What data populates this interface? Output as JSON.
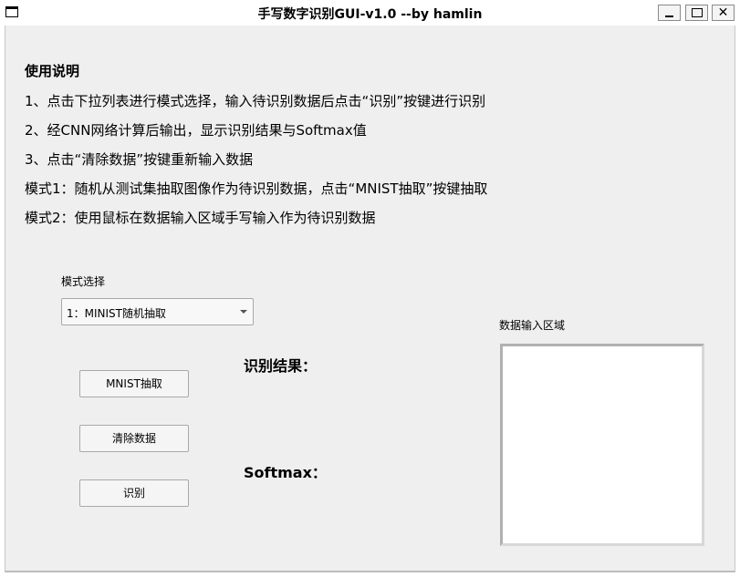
{
  "window": {
    "title": "手写数字识别GUI-v1.0 --by hamlin",
    "controls": [
      "minimize",
      "maximize",
      "close"
    ]
  },
  "instructions": {
    "heading": "使用说明",
    "lines": [
      "1、点击下拉列表进行模式选择，输入待识别数据后点击“识别”按键进行识别",
      "2、经CNN网络计算后输出，显示识别结果与Softmax值",
      "3、点击“清除数据”按键重新输入数据",
      "模式1：随机从测试集抽取图像作为待识别数据，点击“MNIST抽取”按键抽取",
      "模式2：使用鼠标在数据输入区域手写输入作为待识别数据"
    ]
  },
  "mode": {
    "label": "模式选择",
    "selected": "1：MINIST随机抽取"
  },
  "buttons": {
    "mnist": "MNIST抽取",
    "clear": "清除数据",
    "recognize": "识别"
  },
  "results": {
    "result_label": "识别结果：",
    "softmax_label": "Softmax："
  },
  "canvas": {
    "label": "数据输入区域"
  }
}
